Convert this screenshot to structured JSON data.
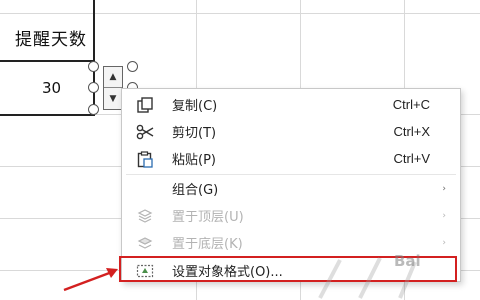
{
  "sheet": {
    "header_cell": "提醒天数",
    "value_cell": "30"
  },
  "spinner": {
    "up_icon": "▲",
    "down_icon": "▼"
  },
  "context_menu": {
    "items": [
      {
        "label": "复制(C)",
        "shortcut": "Ctrl+C",
        "icon": "copy-icon",
        "enabled": true
      },
      {
        "label": "剪切(T)",
        "shortcut": "Ctrl+X",
        "icon": "scissors-icon",
        "enabled": true
      },
      {
        "label": "粘贴(P)",
        "shortcut": "Ctrl+V",
        "icon": "paste-icon",
        "enabled": true
      },
      {
        "label": "组合(G)",
        "arrow": "›",
        "enabled": true
      },
      {
        "label": "置于顶层(U)",
        "arrow": "›",
        "icon": "bring-to-front-icon",
        "enabled": false
      },
      {
        "label": "置于底层(K)",
        "arrow": "›",
        "icon": "send-to-back-icon",
        "enabled": false
      },
      {
        "label": "设置对象格式(O)...",
        "icon": "format-object-icon",
        "enabled": true,
        "highlighted": true
      }
    ]
  },
  "colors": {
    "highlight_border": "#d32020",
    "arrow": "#d32020"
  },
  "watermark": "Bai"
}
